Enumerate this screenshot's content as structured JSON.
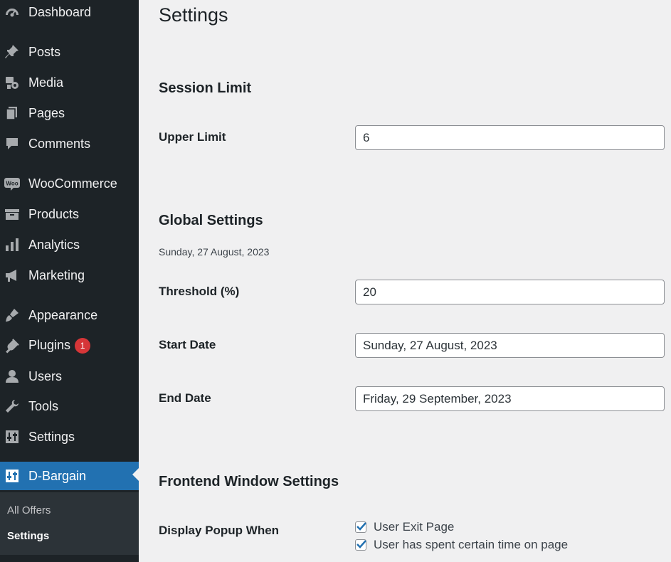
{
  "sidebar": {
    "items": [
      {
        "label": "Dashboard",
        "icon": "dashboard-icon"
      },
      {
        "label": "Posts",
        "icon": "pushpin-icon"
      },
      {
        "label": "Media",
        "icon": "media-icon"
      },
      {
        "label": "Pages",
        "icon": "pages-icon"
      },
      {
        "label": "Comments",
        "icon": "comment-icon"
      },
      {
        "label": "WooCommerce",
        "icon": "woo-icon"
      },
      {
        "label": "Products",
        "icon": "archive-icon"
      },
      {
        "label": "Analytics",
        "icon": "bar-chart-icon"
      },
      {
        "label": "Marketing",
        "icon": "megaphone-icon"
      },
      {
        "label": "Appearance",
        "icon": "paintbrush-icon"
      },
      {
        "label": "Plugins",
        "icon": "plug-icon",
        "badge": "1"
      },
      {
        "label": "Users",
        "icon": "user-icon"
      },
      {
        "label": "Tools",
        "icon": "wrench-icon"
      },
      {
        "label": "Settings",
        "icon": "settings-sliders-icon"
      },
      {
        "label": "D-Bargain",
        "icon": "d-bargain-icon",
        "current": true
      }
    ],
    "submenu": [
      {
        "label": "All Offers"
      },
      {
        "label": "Settings",
        "active": true
      }
    ]
  },
  "main": {
    "page_title": "Settings",
    "session": {
      "title": "Session Limit",
      "upper_limit_label": "Upper Limit",
      "upper_limit_value": "6"
    },
    "global": {
      "title": "Global Settings",
      "date_desc": "Sunday, 27 August, 2023",
      "threshold_label": "Threshold (%)",
      "threshold_value": "20",
      "start_label": "Start Date",
      "start_value": "Sunday, 27 August, 2023",
      "end_label": "End Date",
      "end_value": "Friday, 29 September, 2023"
    },
    "frontend": {
      "title": "Frontend Window Settings",
      "display_label": "Display Popup When",
      "options": [
        {
          "label": "User Exit Page",
          "checked": true
        },
        {
          "label": "User has spent certain time on page",
          "checked": true
        }
      ]
    }
  },
  "colors": {
    "sidebar_bg": "#1d2327",
    "accent": "#2271b1",
    "badge": "#d63638",
    "page_bg": "#f0f0f1"
  }
}
